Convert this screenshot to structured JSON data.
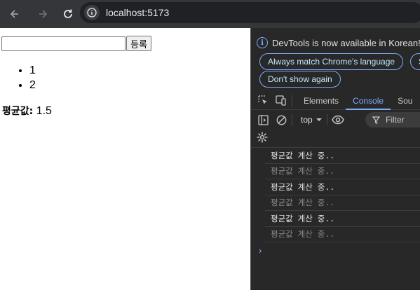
{
  "browser": {
    "url": "localhost:5173",
    "icons": [
      "back-arrow-icon",
      "forward-arrow-icon",
      "reload-icon",
      "site-info-icon"
    ]
  },
  "page": {
    "input_value": "",
    "submit_label": "등록",
    "list": [
      "1",
      "2"
    ],
    "average_label": "평균값:",
    "average_value": "1.5"
  },
  "devtools": {
    "notice": "DevTools is now available in Korean!",
    "btn_match": "Always match Chrome's language",
    "btn_switch": "S",
    "btn_dont_show": "Don't show again",
    "tabs": [
      "Elements",
      "Console",
      "Sou"
    ],
    "active_tab": "Console",
    "context": "top",
    "filter_placeholder": "Filter",
    "logs": [
      {
        "text": "평균값 계산 중..",
        "dim": false
      },
      {
        "text": "평균값 계산 중..",
        "dim": true
      },
      {
        "text": "평균값 계산 중..",
        "dim": false
      },
      {
        "text": "평균값 계산 중..",
        "dim": true
      },
      {
        "text": "평균값 계산 중..",
        "dim": false
      },
      {
        "text": "평균값 계산 중..",
        "dim": true
      }
    ],
    "accent_color": "#7cacf8"
  }
}
